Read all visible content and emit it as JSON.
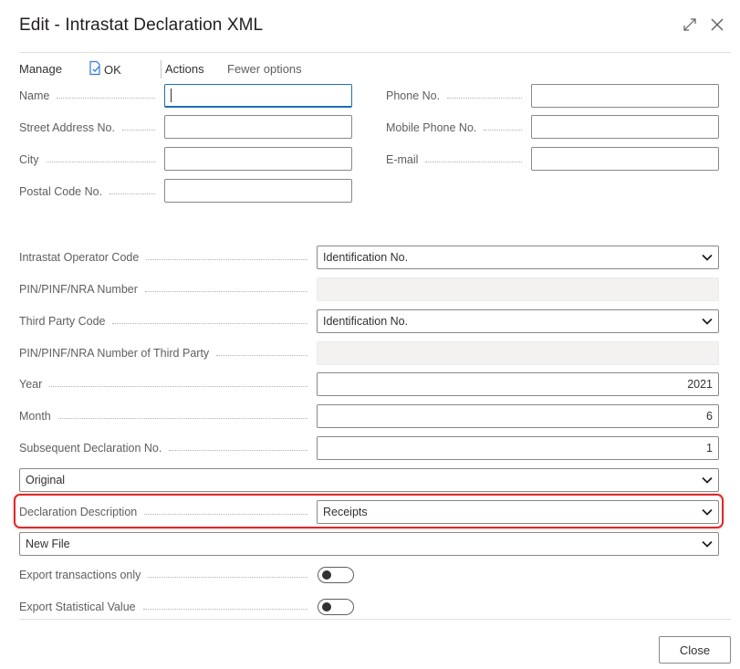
{
  "window": {
    "title": "Edit - Intrastat Declaration XML",
    "expand_icon": "expand-icon",
    "close_icon": "close-icon"
  },
  "actions": {
    "manage": "Manage",
    "ok": "OK",
    "actions": "Actions",
    "fewer_options": "Fewer options"
  },
  "contact": {
    "name_label": "Name",
    "name_value": "",
    "street_label": "Street Address No.",
    "street_value": "",
    "city_label": "City",
    "city_value": "",
    "postal_label": "Postal Code No.",
    "postal_value": "",
    "phone_label": "Phone No.",
    "phone_value": "",
    "mobile_label": "Mobile Phone No.",
    "mobile_value": "",
    "email_label": "E-mail",
    "email_value": ""
  },
  "declaration": {
    "operator_code_label": "Intrastat Operator Code",
    "operator_code_value": "Identification No.",
    "pin_label": "PIN/PINF/NRA Number",
    "pin_value": "",
    "third_party_code_label": "Third Party Code",
    "third_party_code_value": "Identification No.",
    "pin_third_label": "PIN/PINF/NRA Number of Third Party",
    "pin_third_value": "",
    "year_label": "Year",
    "year_value": "2021",
    "month_label": "Month",
    "month_value": "6",
    "subsequent_label": "Subsequent Declaration No.",
    "subsequent_value": "1",
    "type_value": "Original",
    "description_label": "Declaration Description",
    "description_value": "Receipts",
    "file_value": "New File",
    "export_transactions_label": "Export transactions only",
    "export_transactions_on": false,
    "export_statistical_label": "Export Statistical Value",
    "export_statistical_on": false
  },
  "footer": {
    "close_label": "Close"
  },
  "colors": {
    "accent": "#1f6fb5",
    "highlight": "#d92b2b",
    "ok_icon": "#2b7cd3"
  }
}
